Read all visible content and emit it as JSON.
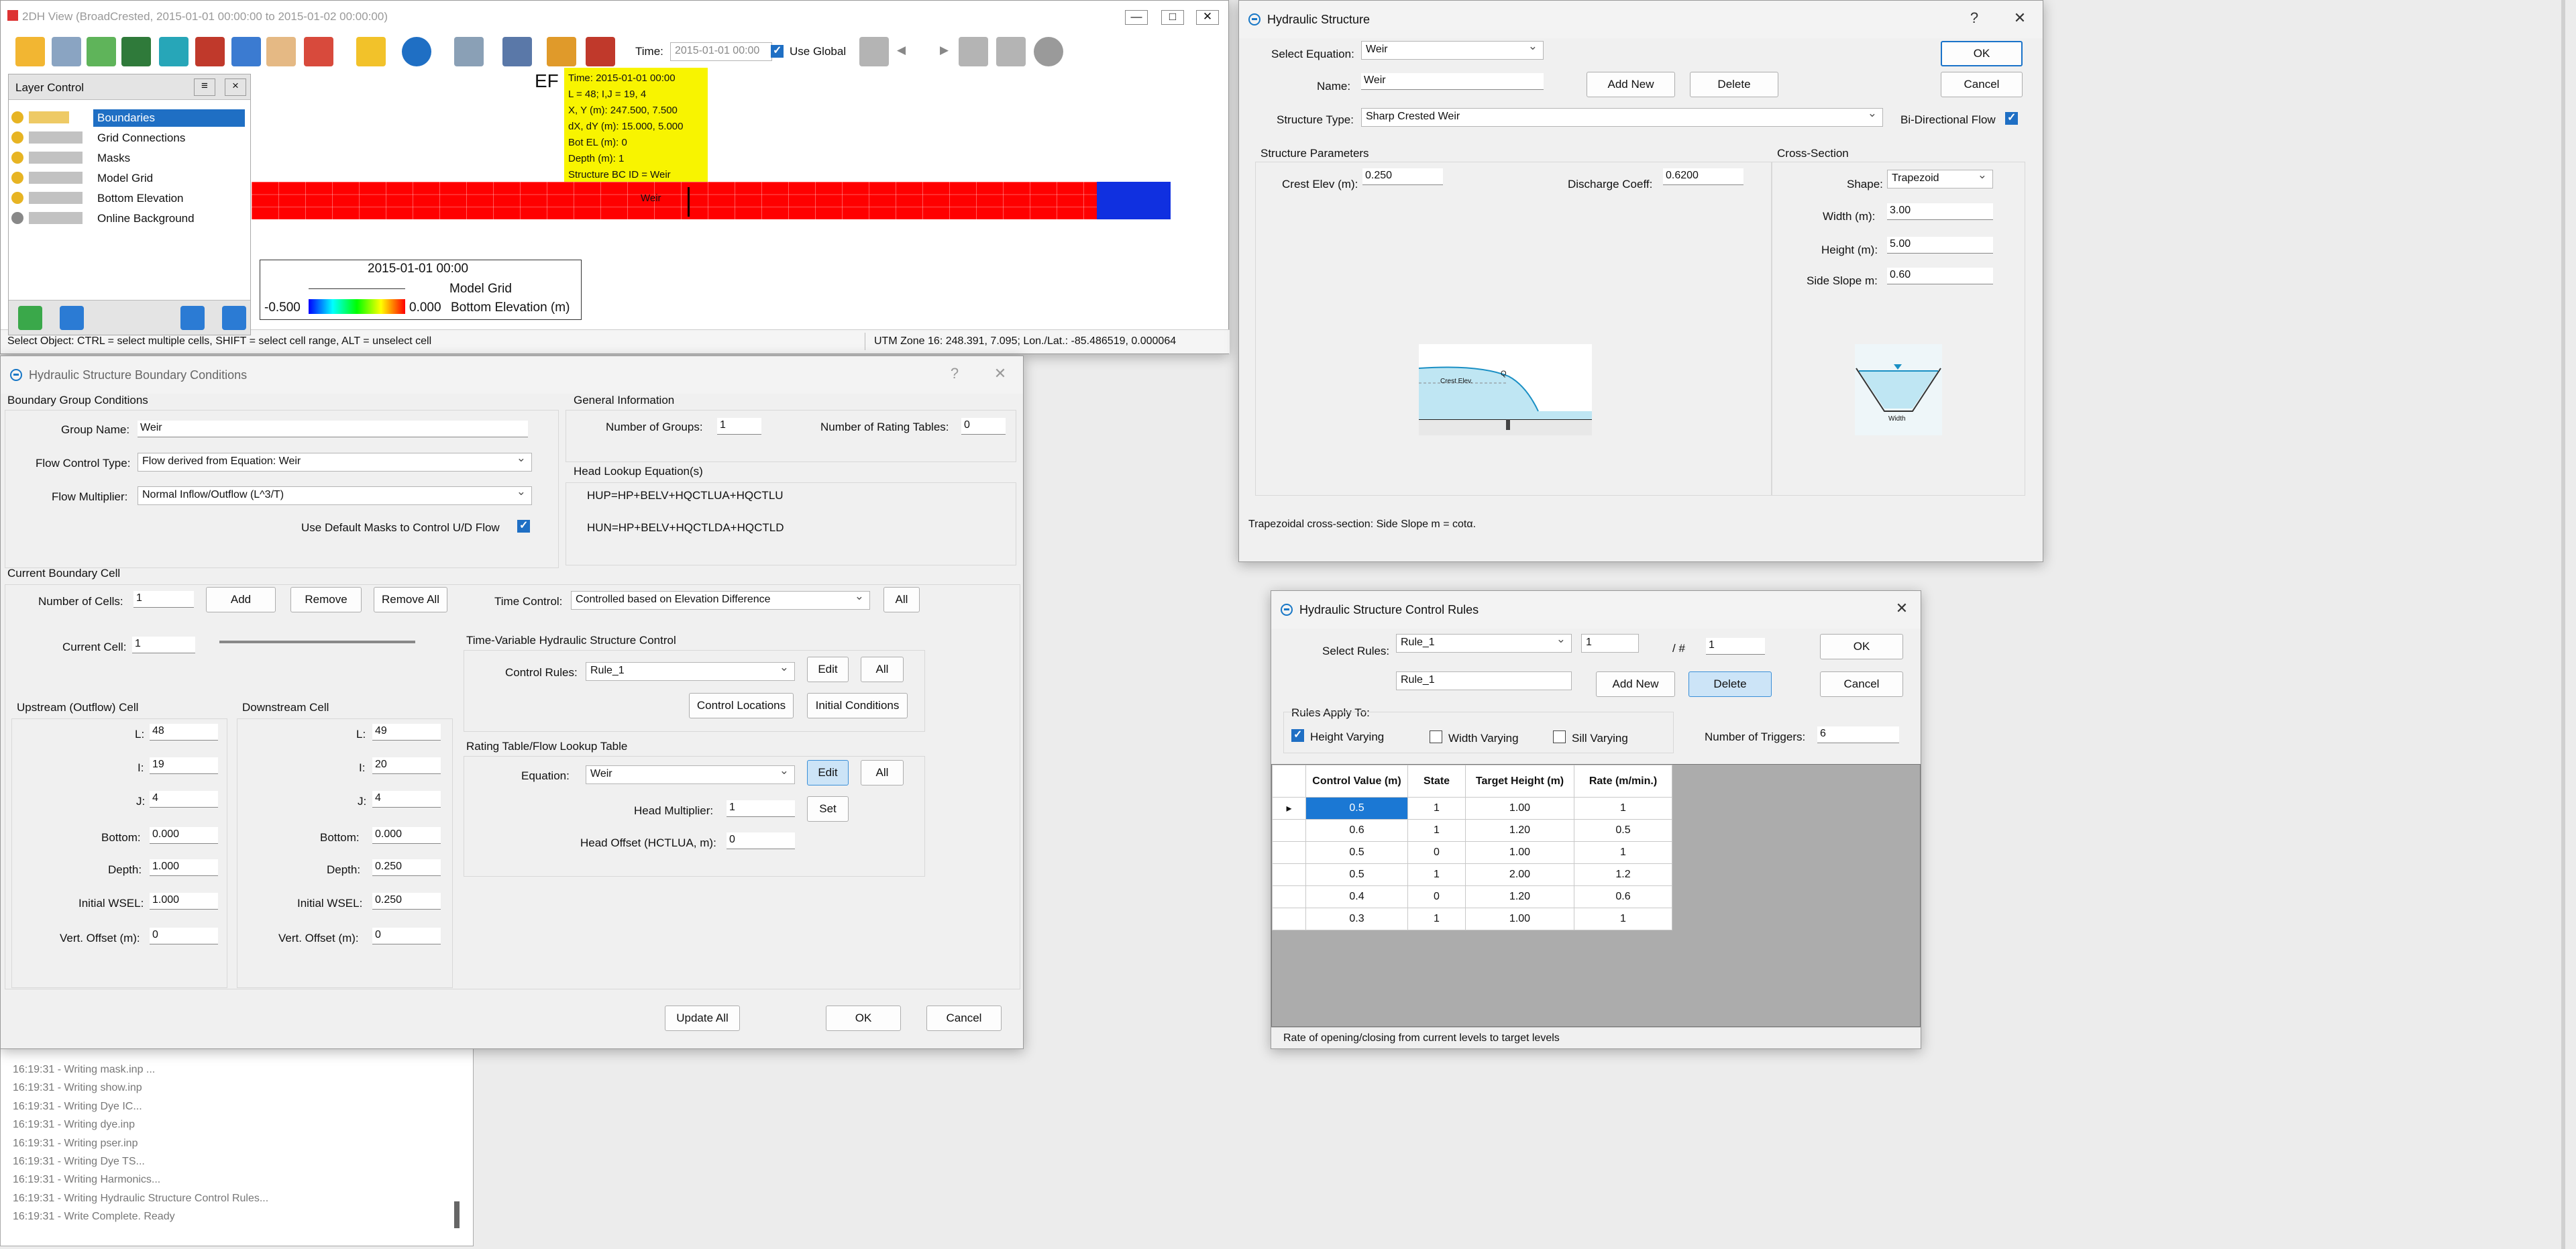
{
  "view2d": {
    "title": "2DH View (BroadCrested, 2015-01-01 00:00:00 to 2015-01-02 00:00:00)",
    "time_label": "Time:",
    "time_value": "2015-01-01 00:00",
    "use_global": "Use Global",
    "status_left": "Select Object: CTRL = select multiple cells, SHIFT = select cell range, ALT = unselect cell",
    "status_right": "UTM Zone 16: 248.391, 7.095; Lon./Lat.: -85.486519, 0.000064",
    "header_text": "EF",
    "tooltip": [
      "Time: 2015-01-01 00:00",
      "L = 48; I,J = 19, 4",
      "X, Y (m): 247.500, 7.500",
      "dX, dY (m): 15.000, 5.000",
      "Bot EL (m): 0",
      "Depth (m): 1",
      "Structure BC ID = Weir"
    ],
    "legend": {
      "time": "2015-01-01 00:00",
      "layer": "Model Grid",
      "min": "-0.500",
      "max": "0.000",
      "name": "Bottom Elevation (m)"
    },
    "weir_label": "Weir",
    "layer_control": {
      "title": "Layer Control",
      "items": [
        "Boundaries",
        "Grid Connections",
        "Masks",
        "Model Grid",
        "Bottom Elevation",
        "Online Background"
      ]
    }
  },
  "log": {
    "lines": [
      "16:19:31 - Writing mask.inp ...",
      "16:19:31 - Writing show.inp",
      "16:19:31 - Writing Dye IC...",
      "16:19:31 - Writing dye.inp",
      "16:19:31 - Writing pser.inp",
      "16:19:31 - Writing Dye TS...",
      "16:19:31 - Writing Harmonics...",
      "16:19:31 - Writing Hydraulic Structure Control Rules...",
      "16:19:31 - Write Complete. Ready"
    ]
  },
  "hsbc": {
    "title": "Hydraulic Structure Boundary Conditions",
    "bgc": {
      "title": "Boundary Group Conditions",
      "group_name_label": "Group Name:",
      "group_name": "Weir",
      "fct_label": "Flow Control Type:",
      "fct": "Flow derived from Equation: Weir",
      "fm_label": "Flow Multiplier:",
      "fm": "Normal Inflow/Outflow (L^3/T)",
      "masks": "Use Default Masks to Control U/D Flow"
    },
    "gi": {
      "title": "General Information",
      "groups_label": "Number of Groups:",
      "groups": "1",
      "rating_label": "Number of Rating Tables:",
      "rating": "0"
    },
    "hle": {
      "title": "Head Lookup Equation(s)",
      "hup": "HUP=HP+BELV+HQCTLUA+HQCTLU",
      "hun": "HUN=HP+BELV+HQCTLDA+HQCTLD"
    },
    "cbc": {
      "title": "Current Boundary Cell",
      "ncells_label": "Number of Cells:",
      "ncells": "1",
      "add": "Add",
      "remove": "Remove",
      "remove_all": "Remove All",
      "time_control_label": "Time Control:",
      "time_control": "Controlled based on Elevation Difference",
      "all": "All",
      "current_label": "Current Cell:",
      "current": "1"
    },
    "tv": {
      "title": "Time-Variable Hydraulic Structure Control",
      "rules_label": "Control Rules:",
      "rules": "Rule_1",
      "edit": "Edit",
      "all": "All",
      "locations": "Control Locations",
      "initial": "Initial Conditions"
    },
    "rt": {
      "title": "Rating Table/Flow Lookup Table",
      "eq_label": "Equation:",
      "eq": "Weir",
      "edit": "Edit",
      "all": "All",
      "hm_label": "Head Multiplier:",
      "hm": "1",
      "set": "Set",
      "ho_label": "Head Offset (HCTLUA, m):",
      "ho": "0"
    },
    "up": {
      "title": "Upstream (Outflow) Cell",
      "l": "48",
      "i": "19",
      "j": "4",
      "bottom": "0.000",
      "depth": "1.000",
      "wsel": "1.000",
      "voff": "0"
    },
    "down": {
      "title": "Downstream Cell",
      "l": "49",
      "i": "20",
      "j": "4",
      "bottom": "0.000",
      "depth": "0.250",
      "wsel": "0.250",
      "voff": "0"
    },
    "labels": {
      "l": "L:",
      "i": "I:",
      "j": "J:",
      "bottom": "Bottom:",
      "depth": "Depth:",
      "wsel": "Initial WSEL:",
      "voff": "Vert. Offset (m):"
    },
    "update_all": "Update All",
    "ok": "OK",
    "cancel": "Cancel"
  },
  "hs": {
    "title": "Hydraulic Structure",
    "eq_label": "Select Equation:",
    "eq": "Weir",
    "name_label": "Name:",
    "name": "Weir",
    "add_new": "Add New",
    "delete": "Delete",
    "ok": "OK",
    "cancel": "Cancel",
    "type_label": "Structure Type:",
    "type": "Sharp Crested Weir",
    "bidir": "Bi-Directional Flow",
    "params_title": "Structure Parameters",
    "crest_label": "Crest Elev (m):",
    "crest": "0.250",
    "dc_label": "Discharge Coeff:",
    "dc": "0.6200",
    "xs_title": "Cross-Section",
    "shape_label": "Shape:",
    "shape": "Trapezoid",
    "width_label": "Width (m):",
    "width": "3.00",
    "height_label": "Height (m):",
    "height": "5.00",
    "slope_label": "Side Slope m:",
    "slope": "0.60",
    "diagram_crest": "Crest Elev.",
    "diagram_q": "Q",
    "diagram_width": "Width",
    "note": "Trapezoidal cross-section: Side Slope m = cotα."
  },
  "rules": {
    "title": "Hydraulic Structure Control Rules",
    "select_label": "Select Rules:",
    "select": "Rule_1",
    "num": "1",
    "of_label": "/ #",
    "of": "1",
    "name": "Rule_1",
    "add_new": "Add New",
    "delete": "Delete",
    "ok": "OK",
    "cancel": "Cancel",
    "apply_label": "Rules Apply To:",
    "height_varying": "Height Varying",
    "width_varying": "Width Varying",
    "sill_varying": "Sill Varying",
    "triggers_label": "Number of Triggers:",
    "triggers": "6",
    "columns": [
      "Control Value (m)",
      "State",
      "Target Height (m)",
      "Rate (m/min.)"
    ],
    "rows": [
      [
        "0.5",
        "1",
        "1.00",
        "1"
      ],
      [
        "0.6",
        "1",
        "1.20",
        "0.5"
      ],
      [
        "0.5",
        "0",
        "1.00",
        "1"
      ],
      [
        "0.5",
        "1",
        "2.00",
        "1.2"
      ],
      [
        "0.4",
        "0",
        "1.20",
        "0.6"
      ],
      [
        "0.3",
        "1",
        "1.00",
        "1"
      ]
    ],
    "status": "Rate of opening/closing from current levels to target levels"
  }
}
